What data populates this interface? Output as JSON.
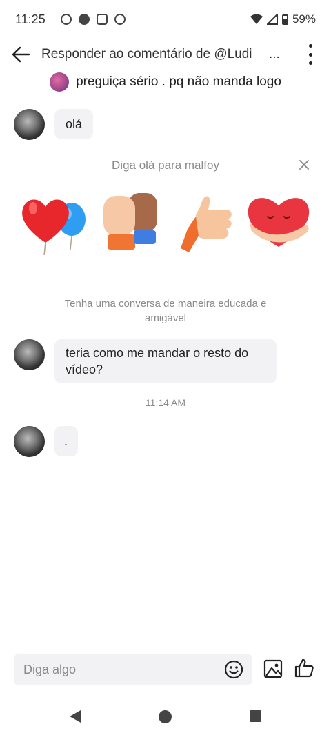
{
  "status_bar": {
    "time": "11:25",
    "battery": "59%",
    "icons": [
      "record-icon",
      "facebook-icon",
      "instagram-icon",
      "shazam-icon",
      "wifi-icon",
      "signal-icon",
      "battery-icon"
    ]
  },
  "header": {
    "title": "Responder ao comentário de @Ludi",
    "title_ellipsis": "..."
  },
  "quoted_comment": {
    "text": "preguiça sério . pq não manda logo"
  },
  "messages": [
    {
      "text": "olá"
    },
    {
      "line1": "teria como me mandar o resto do",
      "line2": "vídeo?"
    },
    {
      "text": "."
    }
  ],
  "greeting": {
    "title": "Diga olá para malfoy",
    "hint": "Tenha uma conversa de maneira educada e amigável",
    "stickers": [
      "heart-balloons-sticker",
      "high-five-sticker",
      "thumbs-up-sticker",
      "hugging-heart-sticker"
    ]
  },
  "timestamp": "11:14 AM",
  "composer": {
    "placeholder": "Diga algo"
  },
  "colors": {
    "bubble": "#f2f2f5",
    "muted_text": "#8a8a8a",
    "background": "#ffffff"
  }
}
